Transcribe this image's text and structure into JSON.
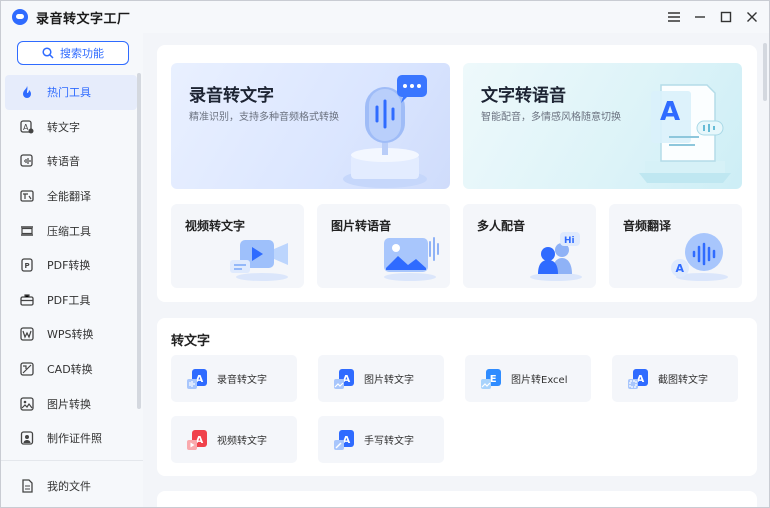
{
  "app": {
    "title": "录音转文字工厂"
  },
  "window_controls": {
    "menu": "☰",
    "minimize": "—",
    "maximize": "☐",
    "close": "✕"
  },
  "sidebar": {
    "search_label": "搜索功能",
    "items": [
      {
        "label": "热门工具",
        "icon": "fire-icon"
      },
      {
        "label": "转文字",
        "icon": "text-convert-icon"
      },
      {
        "label": "转语音",
        "icon": "voice-icon"
      },
      {
        "label": "全能翻译",
        "icon": "translate-icon"
      },
      {
        "label": "压缩工具",
        "icon": "compress-icon"
      },
      {
        "label": "PDF转换",
        "icon": "pdf-convert-icon"
      },
      {
        "label": "PDF工具",
        "icon": "toolbox-icon"
      },
      {
        "label": "WPS转换",
        "icon": "wps-icon"
      },
      {
        "label": "CAD转换",
        "icon": "cad-icon"
      },
      {
        "label": "图片转换",
        "icon": "image-icon"
      },
      {
        "label": "制作证件照",
        "icon": "id-photo-icon"
      }
    ],
    "bottom_label": "我的文件"
  },
  "hot": {
    "hero1": {
      "title": "录音转文字",
      "subtitle": "精准识别，支持多种音频格式转换"
    },
    "hero2": {
      "title": "文字转语音",
      "subtitle": "智能配音，多情感风格随意切换"
    },
    "cards": [
      {
        "label": "视频转文字"
      },
      {
        "label": "图片转语音"
      },
      {
        "label": "多人配音"
      },
      {
        "label": "音频翻译"
      }
    ]
  },
  "text_section": {
    "title": "转文字",
    "tools": [
      {
        "label": "录音转文字",
        "badge": "A"
      },
      {
        "label": "图片转文字",
        "badge": "A"
      },
      {
        "label": "图片转Excel",
        "badge": "E"
      },
      {
        "label": "截图转文字",
        "badge": "A"
      },
      {
        "label": "视频转文字",
        "badge": "A"
      },
      {
        "label": "手写转文字",
        "badge": "A"
      }
    ]
  },
  "colors": {
    "accent": "#2f6bff",
    "video_red": "#f0414b"
  }
}
